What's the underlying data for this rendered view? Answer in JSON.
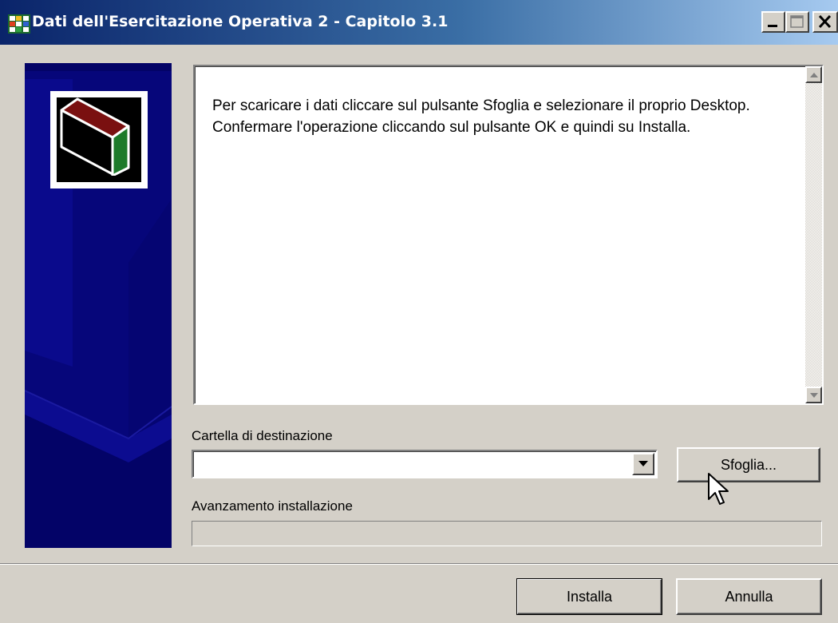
{
  "window": {
    "title": "Dati dell'Esercitazione Operativa 2 - Capitolo 3.1",
    "icon": "setup-app-icon",
    "controls": [
      "minimize-icon",
      "maximize-icon",
      "close-icon"
    ]
  },
  "banner": {
    "logo_icon": "installer-box-icon",
    "colors": {
      "background": "#030367",
      "box_red": "#7a1010",
      "box_green": "#1e7a2a"
    }
  },
  "message": {
    "text": "Per scaricare i dati cliccare sul pulsante Sfoglia e selezionare il proprio Desktop. Confermare l'operazione cliccando sul pulsante OK e quindi su Installa."
  },
  "destination": {
    "label": "Cartella di destinazione",
    "value": "",
    "browse_label": "Sfoglia..."
  },
  "progress": {
    "label": "Avanzamento installazione",
    "value": 0
  },
  "footer": {
    "install_label": "Installa",
    "cancel_label": "Annulla"
  }
}
